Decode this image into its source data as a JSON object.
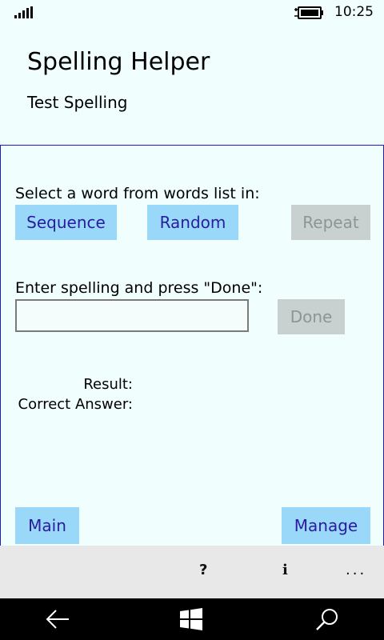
{
  "status_bar": {
    "time": "10:25"
  },
  "header": {
    "app_title": "Spelling Helper",
    "page_subtitle": "Test Spelling"
  },
  "test": {
    "select_prompt": "Select a word from words list in:",
    "sequence_label": "Sequence",
    "random_label": "Random",
    "repeat_label": "Repeat",
    "enter_prompt": "Enter spelling and press \"Done\":",
    "spelling_input_value": "",
    "done_label": "Done",
    "result_label": "Result:",
    "correct_answer_label": "Correct Answer:"
  },
  "footer_buttons": {
    "main_label": "Main",
    "manage_label": "Manage"
  },
  "app_bar": {
    "help_label": "?",
    "info_label": "i",
    "more_label": "..."
  },
  "colors": {
    "background": "#f0fefe",
    "button_bg": "#99d8f8",
    "button_text": "#2a1ca0",
    "disabled_bg": "#c8d0d0",
    "disabled_text": "#8f9494",
    "panel_border": "#1c1ccc"
  },
  "icons": [
    "signal-strength-icon",
    "battery-icon",
    "back-arrow-icon",
    "windows-start-icon",
    "search-icon"
  ]
}
